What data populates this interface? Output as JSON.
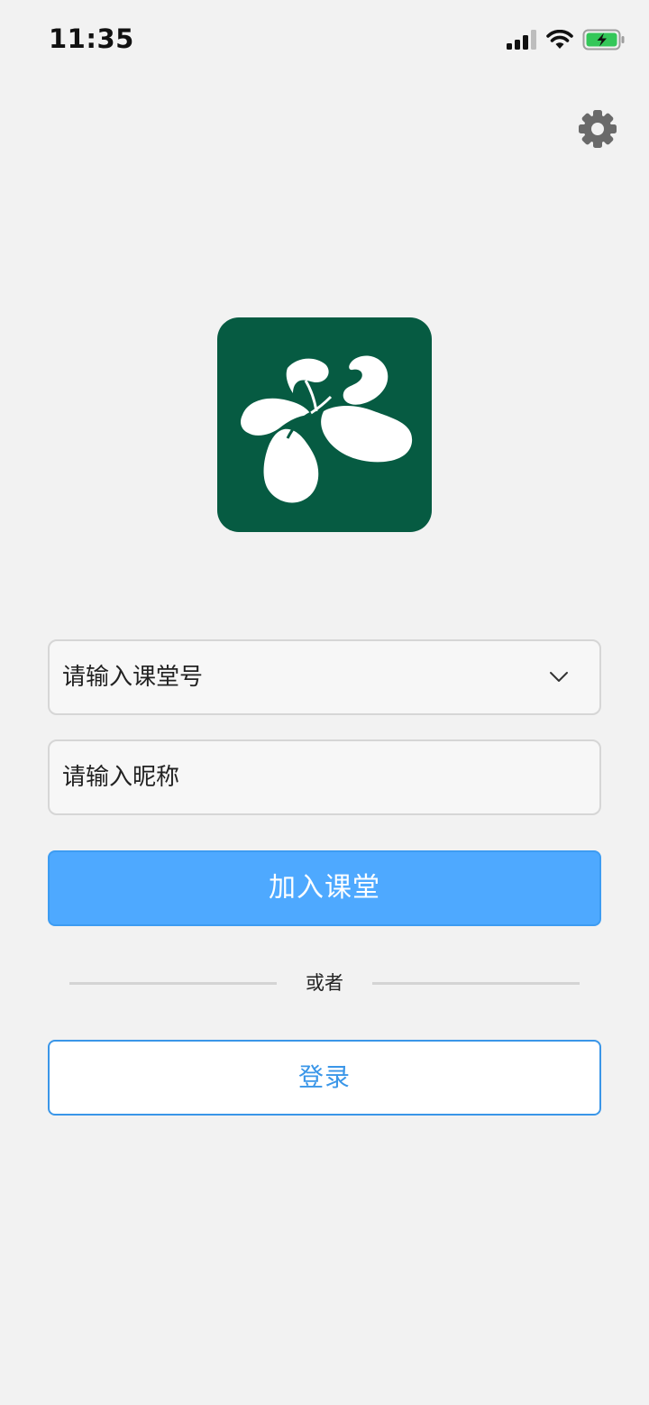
{
  "status_bar": {
    "time": "11:35",
    "icons": [
      "signal-icon",
      "wifi-icon",
      "battery-charging-icon"
    ]
  },
  "header": {
    "settings_icon": "gear-icon"
  },
  "logo": {
    "icon": "app-logo",
    "background_color": "#065b42"
  },
  "form": {
    "class_field": {
      "placeholder": "请输入课堂号",
      "dropdown_icon": "chevron-down-icon"
    },
    "nickname_field": {
      "placeholder": "请输入昵称"
    },
    "join_button_label": "加入课堂",
    "divider_text": "或者",
    "login_button_label": "登录"
  },
  "colors": {
    "background": "#f2f2f2",
    "primary_button": "#4ea9ff",
    "accent": "#3a96e8",
    "logo_green": "#065b42"
  }
}
